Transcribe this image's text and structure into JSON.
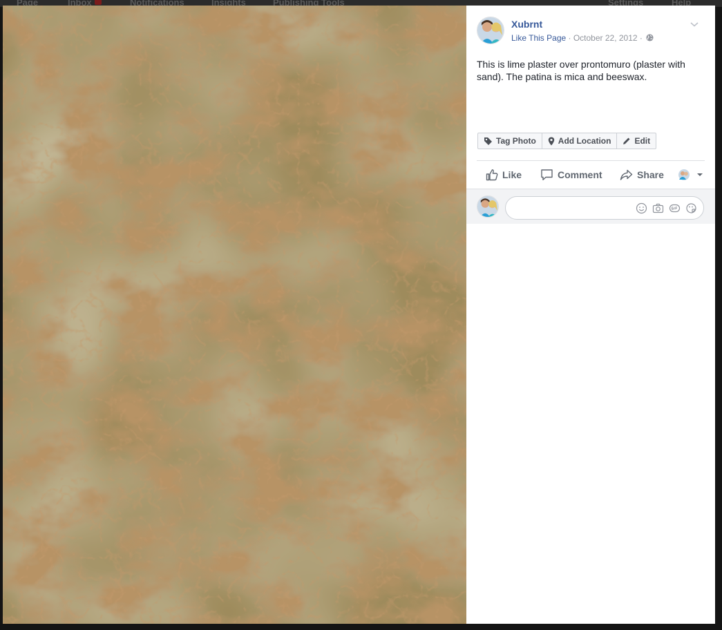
{
  "background_nav": {
    "items": [
      "Page",
      "Inbox",
      "Notifications",
      "Insights",
      "Publishing Tools",
      "Settings",
      "Help"
    ]
  },
  "photo": {
    "icon": "marble-plaster-photo",
    "colors": {
      "base": "#9a8557",
      "light": "#b3a47a",
      "vein": "#7a4a22"
    }
  },
  "post": {
    "page_name": "Xubrnt",
    "like_page": "Like This Page",
    "separator": " · ",
    "date": "October 22, 2012",
    "text": "This is lime plaster over prontomuro (plaster with sand). The patina is mica and beeswax."
  },
  "photo_actions": {
    "tag_photo": "Tag Photo",
    "add_location": "Add Location",
    "edit": "Edit"
  },
  "ufi": {
    "like": "Like",
    "comment": "Comment",
    "share": "Share"
  },
  "comment_box": {
    "placeholder": "",
    "value": "",
    "icons": [
      "emoji-icon",
      "camera-icon",
      "gif-icon",
      "sticker-icon"
    ]
  },
  "colors": {
    "link": "#365899",
    "meta": "#90949c",
    "action_text": "#606770"
  }
}
